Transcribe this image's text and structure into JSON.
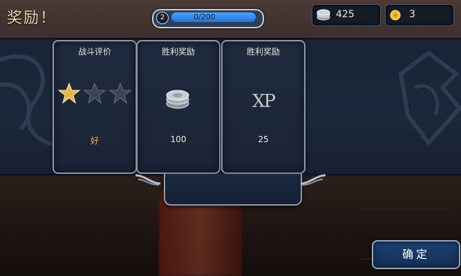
{
  "header": {
    "title": "奖励！",
    "level": "2",
    "xp_progress": "0/200",
    "xp_fraction": 0.0,
    "silver": "425",
    "gold": "3"
  },
  "cards": [
    {
      "title": "战斗评价",
      "value": "好",
      "stars_filled": 1,
      "stars_total": 3
    },
    {
      "title": "胜利奖励",
      "value": "100",
      "icon": "silver-coins-icon"
    },
    {
      "title": "胜利奖励",
      "value": "25",
      "label": "XP"
    }
  ],
  "confirm_label": "确定",
  "colors": {
    "panel": "#1c273a",
    "card_border": "#8e9aae",
    "xp_bar": "#4aa7ff",
    "star_gold": "#e8b44c",
    "confirm_bg": "#1d3f70"
  }
}
